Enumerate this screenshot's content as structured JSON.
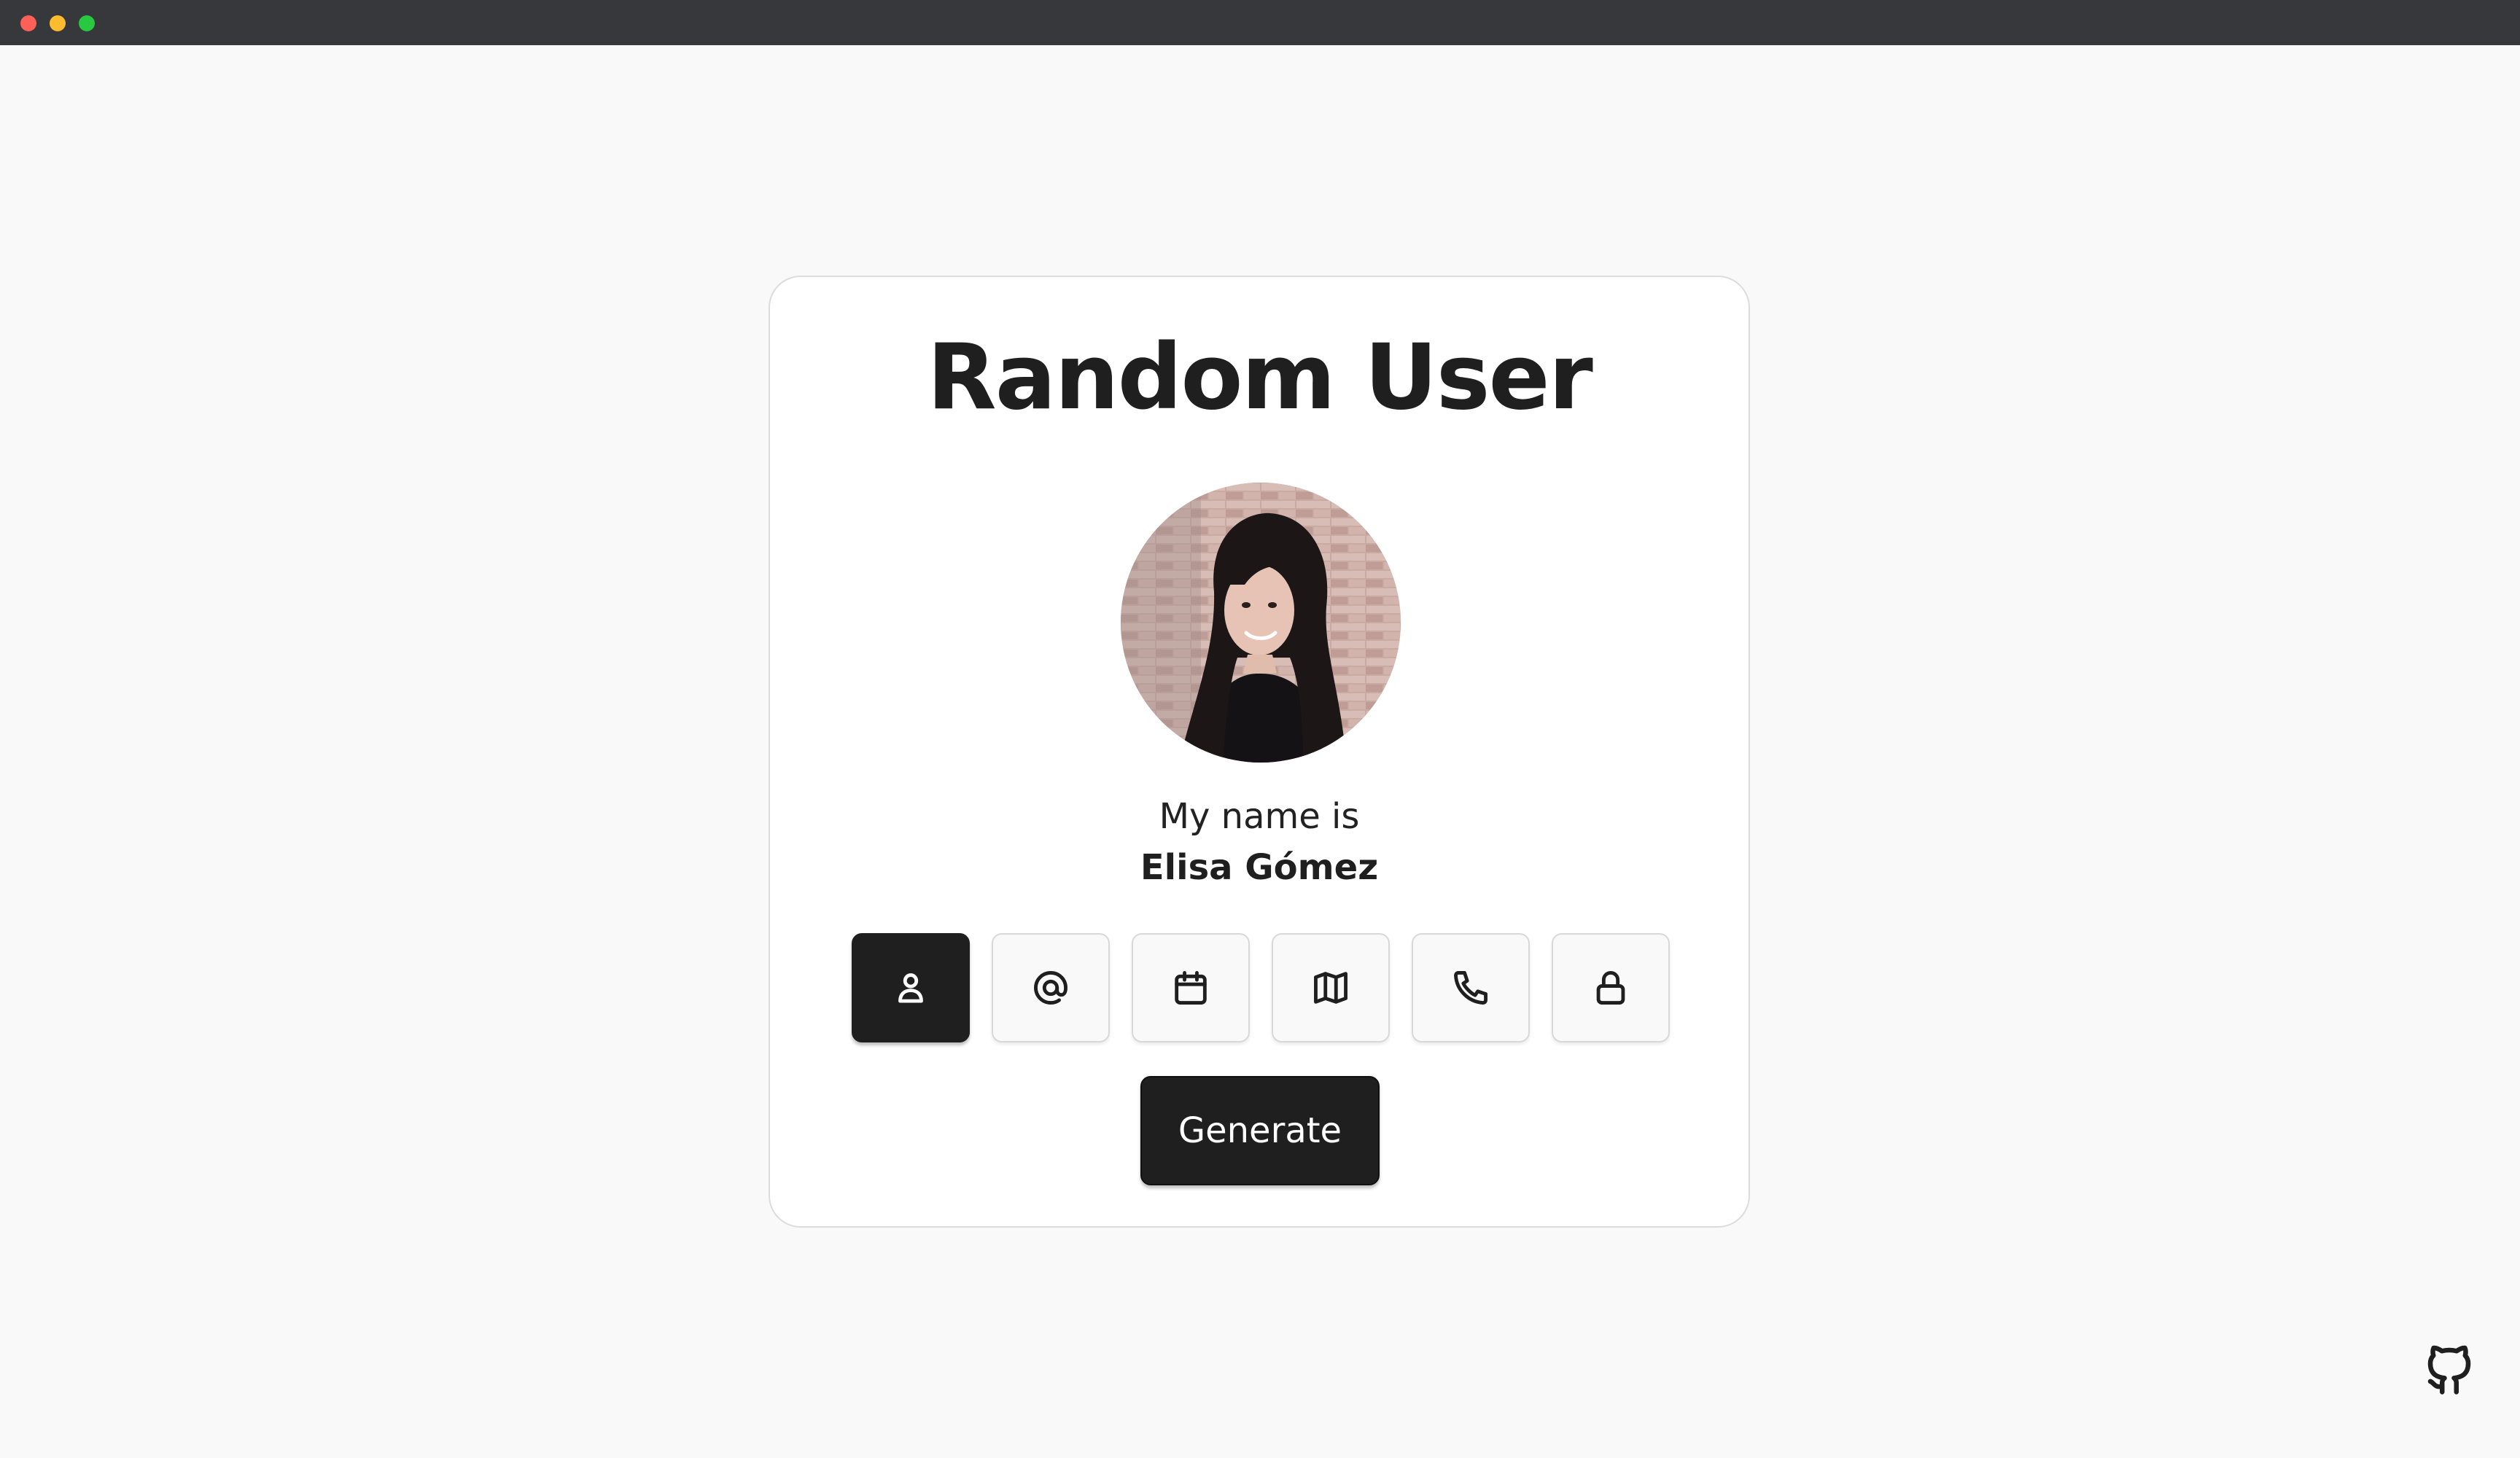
{
  "window": {
    "controls": [
      "close",
      "minimize",
      "maximize"
    ]
  },
  "card": {
    "title": "Random User",
    "avatar_alt": "User portrait",
    "intro": "My name is",
    "value": "Elisa Gómez"
  },
  "tabs": [
    {
      "icon": "user-icon",
      "label": "name",
      "active": true
    },
    {
      "icon": "at-sign-icon",
      "label": "email",
      "active": false
    },
    {
      "icon": "calendar-icon",
      "label": "birthday",
      "active": false
    },
    {
      "icon": "map-icon",
      "label": "address",
      "active": false
    },
    {
      "icon": "phone-icon",
      "label": "phone",
      "active": false
    },
    {
      "icon": "lock-icon",
      "label": "password",
      "active": false
    }
  ],
  "actions": {
    "generate_label": "Generate"
  },
  "footer": {
    "github_icon": "github-icon"
  },
  "colors": {
    "accent": "#1f1f1f",
    "background": "#f9f9f9",
    "card": "#ffffff"
  }
}
